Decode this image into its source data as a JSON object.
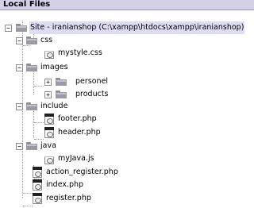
{
  "panel": {
    "title": "Local Files"
  },
  "tree": {
    "root": {
      "label": "Site - iranianshop (C:\\xampp\\htdocs\\xampp\\iranianshop)",
      "expander": "−"
    },
    "css": {
      "label": "css",
      "expander": "−"
    },
    "mystyle": {
      "label": "mystyle.css"
    },
    "images": {
      "label": "images",
      "expander": "−"
    },
    "personel": {
      "label": "personel",
      "expander": "+"
    },
    "products": {
      "label": "products",
      "expander": "+"
    },
    "include": {
      "label": "include",
      "expander": "−"
    },
    "footer": {
      "label": "footer.php"
    },
    "header": {
      "label": "header.php"
    },
    "java": {
      "label": "java",
      "expander": "−"
    },
    "myjava": {
      "label": "myJava.js"
    },
    "action_register": {
      "label": "action_register.php"
    },
    "index": {
      "label": "index.php"
    },
    "register": {
      "label": "register.php"
    }
  },
  "colors": {
    "panel_bg": "#d4d0e8",
    "tree_bg": "#ffffff",
    "selection": "#dcdcf4"
  },
  "icons": {
    "folder": "folder-icon",
    "css_file": "css-file-icon",
    "php_file": "php-file-icon",
    "js_file": "js-file-icon"
  }
}
